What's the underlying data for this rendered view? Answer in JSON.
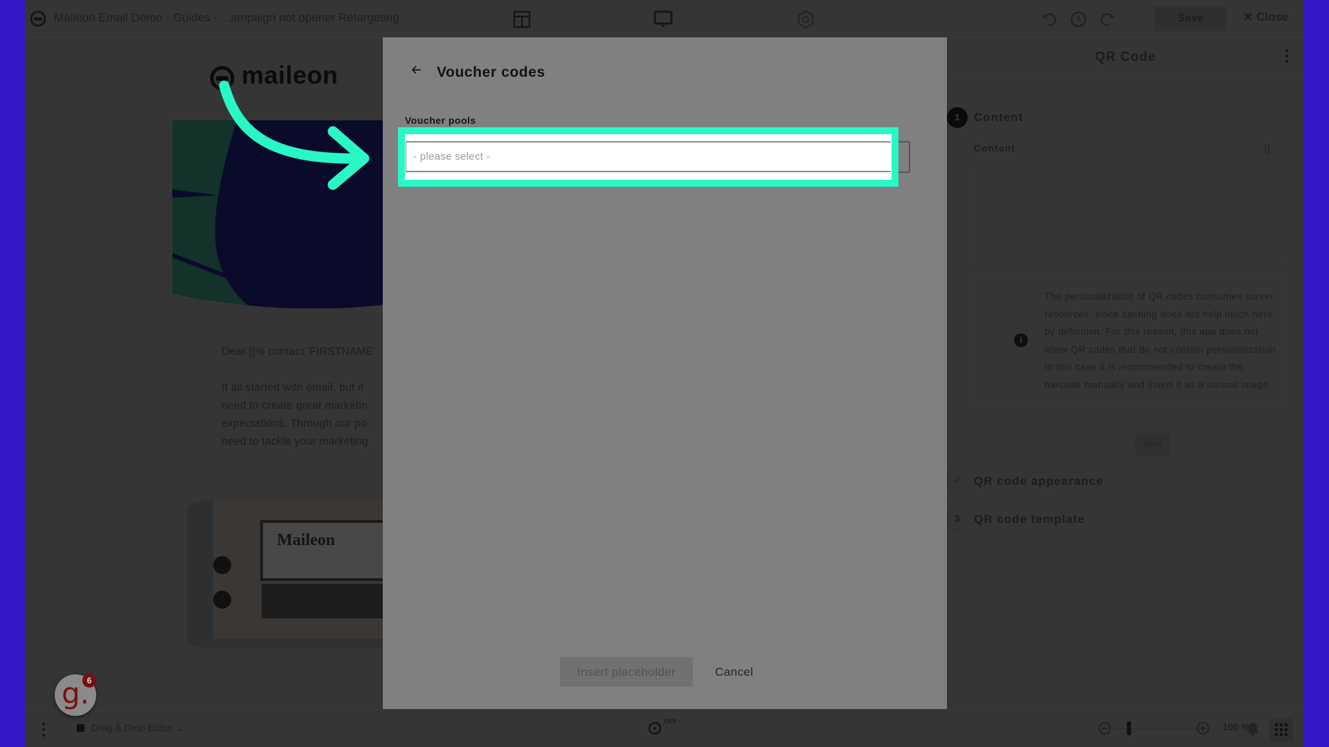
{
  "topbar": {
    "document_title": "Maileon Email Demo - Guides - ...ampaign not opener Retargeting",
    "icons": [
      "app-logo-icon",
      "layout-icon",
      "desktop-preview-icon",
      "settings-gear-icon",
      "undo-icon",
      "history-icon",
      "redo-icon"
    ],
    "save_label": "Save",
    "close_label": "Close"
  },
  "email": {
    "logo_text": "maileon",
    "greeting": "Dear [[% contact 'FIRSTNAME'",
    "body_lines": [
      "It all started with email, but it",
      "need to create great marketin",
      "expectations. Through our po",
      "need to tackle your marketing"
    ],
    "promo_image_caption": "Maileon"
  },
  "right_panel": {
    "title": "QR Code",
    "steps": [
      {
        "number": "1",
        "label": "Content",
        "state": "active"
      },
      {
        "number": "✓",
        "label": "QR code appearance",
        "state": "done"
      },
      {
        "number": "3",
        "label": "QR code template",
        "state": "pending"
      }
    ],
    "content_label": "Content",
    "content_placeholder_icon": "{}",
    "info_text": "The personalization of QR codes consumes server resources, since caching does not help much here by definition. For this reason, this app does not allow QR codes that do not contain personalization. In this case it is recommended to create the barcode manually and insert it as a normal image.",
    "next_label": "Next"
  },
  "modal": {
    "title": "Voucher codes",
    "field_label": "Voucher pools",
    "select_placeholder": "- please select -",
    "insert_label": "Insert placeholder",
    "cancel_label": "Cancel",
    "highlight_color": "#2af7c6"
  },
  "bottombar": {
    "editor_label": "Drag & Drop Editor",
    "autosave_label": "OFF",
    "zoom_level": "100 %"
  },
  "help_badge": {
    "letter": "g.",
    "count": "6"
  },
  "colors": {
    "frame_border": "#3418c8",
    "accent": "#2af7c6",
    "overlay_bg": "#353535",
    "modal_bg": "#808080"
  }
}
